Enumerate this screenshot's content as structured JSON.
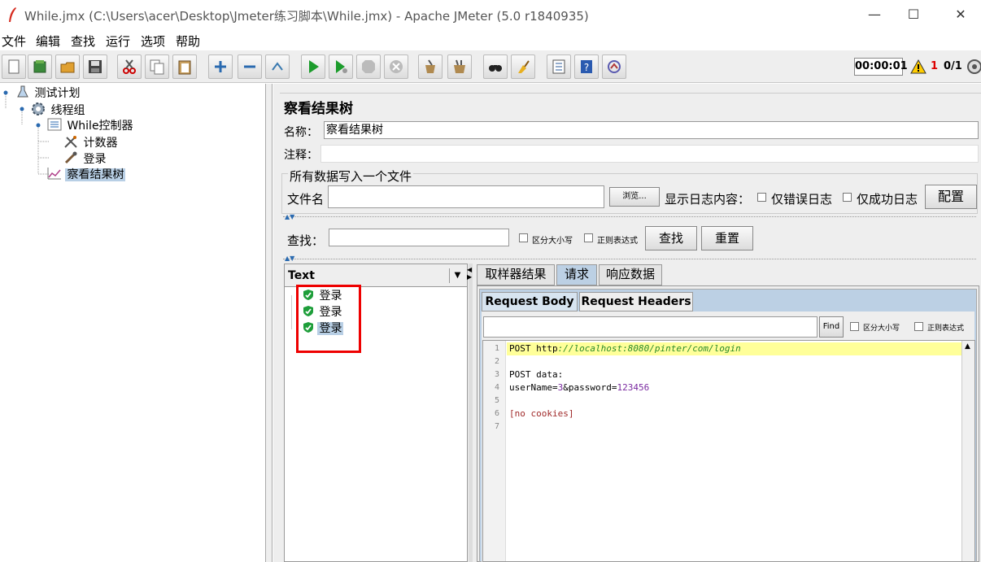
{
  "window": {
    "title": "While.jmx (C:\\Users\\acer\\Desktop\\Jmeter练习脚本\\While.jmx) - Apache JMeter (5.0 r1840935)",
    "controls": [
      "—",
      "☐",
      "✕"
    ]
  },
  "menu": [
    "文件",
    "编辑",
    "查找",
    "运行",
    "选项",
    "帮助"
  ],
  "toolbar": {
    "timer": "00:00:01",
    "warning_count": "1",
    "thread_count": "0/1",
    "icons": [
      "new-icon",
      "templates-icon",
      "open-icon",
      "save-icon",
      "cut-icon",
      "copy-icon",
      "paste-icon",
      "expand-icon",
      "collapse-icon",
      "toggle-icon",
      "start-icon",
      "start-no-pause-icon",
      "stop-icon",
      "shutdown-icon",
      "clear-icon",
      "clear-all-icon",
      "search-icon",
      "reset-search-icon",
      "function-helper-icon",
      "help-icon",
      "logger-icon"
    ]
  },
  "tree": {
    "nodes": [
      {
        "label": "测试计划"
      },
      {
        "label": "线程组"
      },
      {
        "label": "While控制器"
      },
      {
        "label": "计数器"
      },
      {
        "label": "登录"
      },
      {
        "label": "察看结果树",
        "selected": true
      }
    ]
  },
  "panel": {
    "title": "察看结果树",
    "name_label": "名称：",
    "name_value": "察看结果树",
    "comment_label": "注释：",
    "comment_value": "",
    "file_section_title": "所有数据写入一个文件",
    "file_label": "文件名",
    "file_value": "",
    "browse_button": "浏览...",
    "log_display_label": "显示日志内容：",
    "errors_only_label": "仅错误日志",
    "success_only_label": "仅成功日志",
    "configure_button": "配置"
  },
  "search": {
    "label": "查找：",
    "value": "",
    "case_sensitive_label": "区分大小写",
    "regex_label": "正则表达式",
    "find_button": "查找",
    "reset_button": "重置"
  },
  "results": {
    "renderer": "Text",
    "items": [
      {
        "label": "登录"
      },
      {
        "label": "登录"
      },
      {
        "label": "登录",
        "selected": true
      }
    ]
  },
  "detail_tabs": [
    "取样器结果",
    "请求",
    "响应数据"
  ],
  "active_detail_tab": "请求",
  "request_tabs": [
    "Request Body",
    "Request Headers"
  ],
  "active_request_tab": "Request Body",
  "editor_search": {
    "value": "",
    "find_button": "Find",
    "case_sensitive_label": "区分大小写",
    "regex_label": "正则表达式"
  },
  "request_body": {
    "line_numbers": [
      "1",
      "2",
      "3",
      "4",
      "5",
      "6",
      "7"
    ],
    "line1_method": "POST ",
    "line1_scheme": "http",
    "line1_url": "://localhost:8080/pinter/com/login",
    "line3": "POST data:",
    "line4_key1": "userName=",
    "line4_val1": "3",
    "line4_amp": "&password=",
    "line4_val2": "123456",
    "line6": "[no cookies]"
  },
  "colors": {
    "highlight_line": "#ffff99",
    "selection": "#b8cfe5",
    "annotation_box": "#ee0000",
    "success_shield": "#1e9e3a"
  }
}
